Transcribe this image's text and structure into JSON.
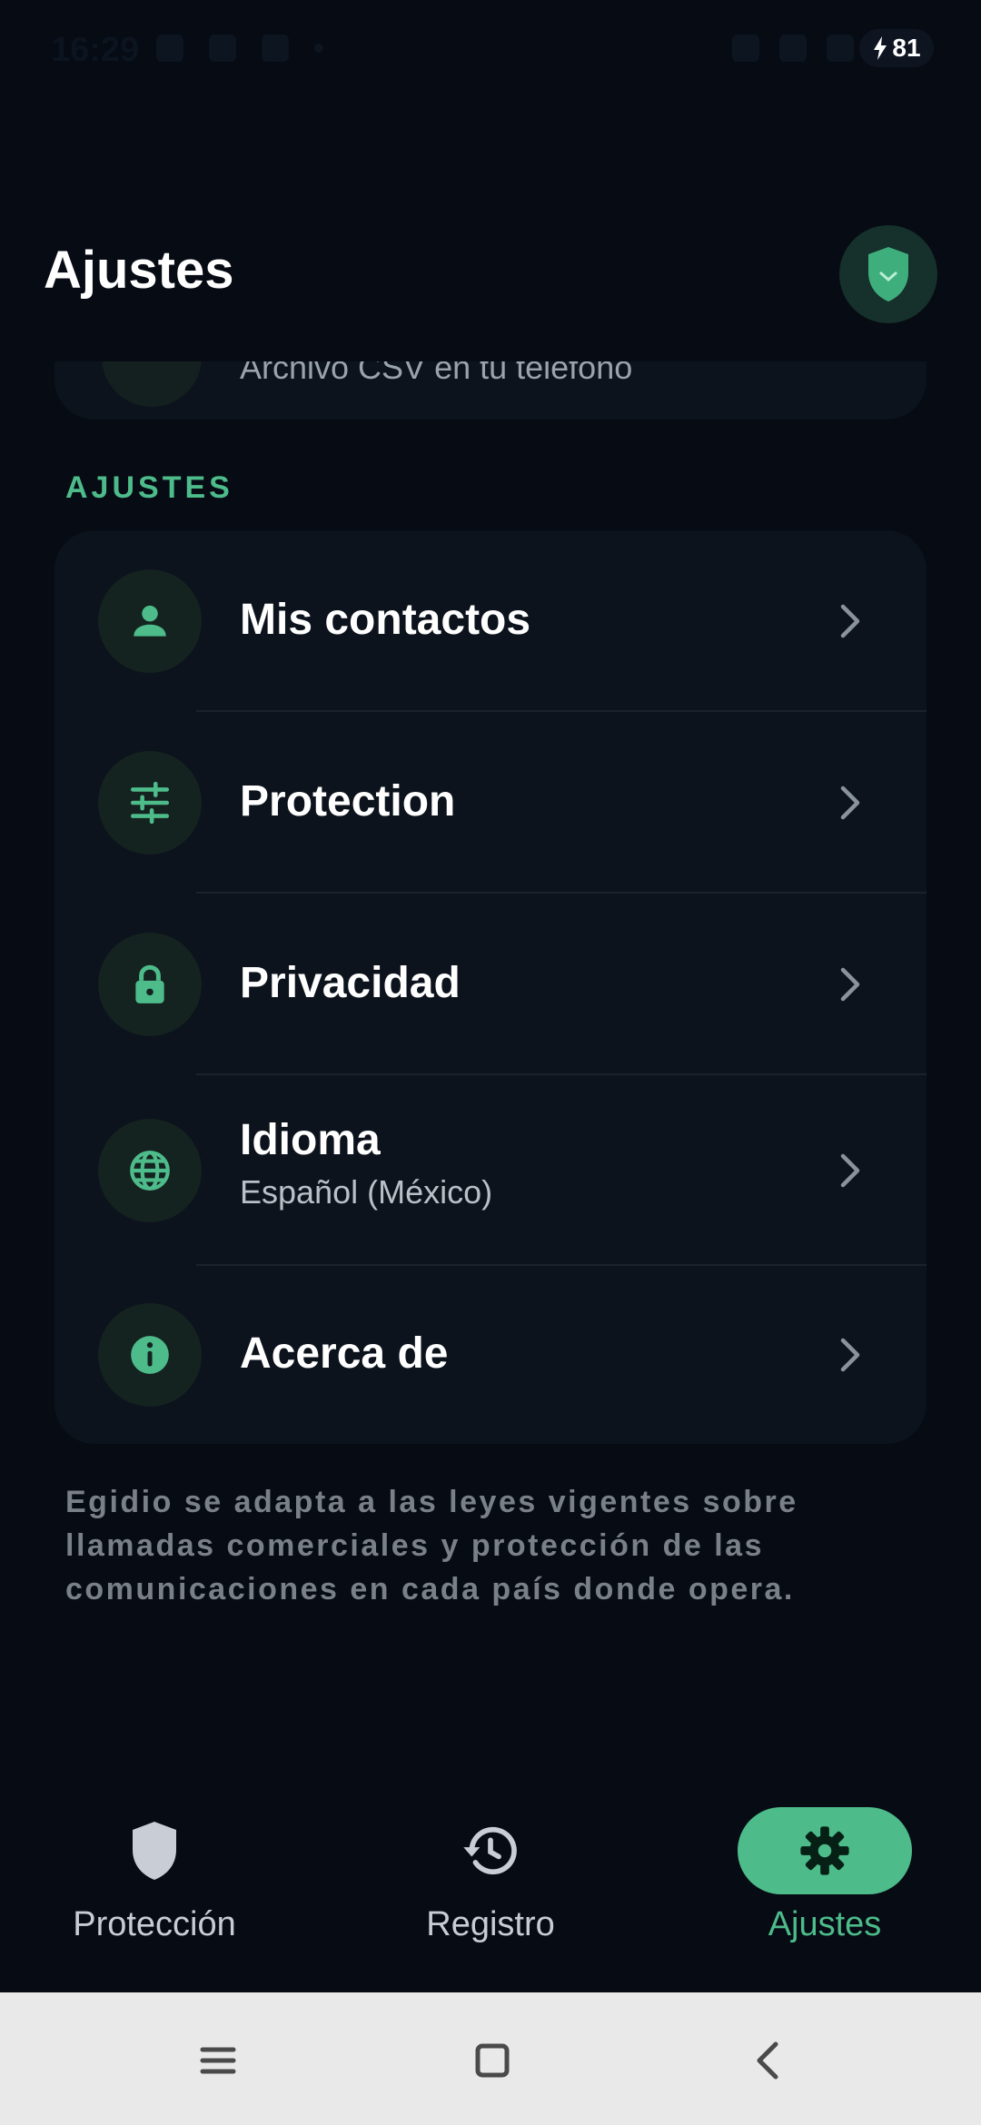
{
  "status_bar": {
    "time": "16:29",
    "battery": "81"
  },
  "header": {
    "title": "Ajustes",
    "badge_icon": "shield-check-icon"
  },
  "previous_item": {
    "subtitle": "Archivo CSV en tu teléfono"
  },
  "section": {
    "label": "AJUSTES"
  },
  "settings": [
    {
      "label": "Mis contactos",
      "icon": "person-icon"
    },
    {
      "label": "Protection",
      "icon": "tune-icon"
    },
    {
      "label": "Privacidad",
      "icon": "lock-icon"
    },
    {
      "label": "Idioma",
      "subtitle": "Español (México)",
      "icon": "globe-icon"
    },
    {
      "label": "Acerca de",
      "icon": "info-icon"
    }
  ],
  "footer_note": "Egidio se adapta a las leyes vigentes sobre llamadas comerciales y protección de las comunicaciones en cada país donde opera.",
  "bottom_nav": [
    {
      "label": "Protección",
      "icon": "shield-icon",
      "active": false
    },
    {
      "label": "Registro",
      "icon": "history-icon",
      "active": false
    },
    {
      "label": "Ajustes",
      "icon": "gear-icon",
      "active": true
    }
  ],
  "colors": {
    "accent": "#4dbb8a",
    "background": "#060b14",
    "card": "#0c131c"
  }
}
